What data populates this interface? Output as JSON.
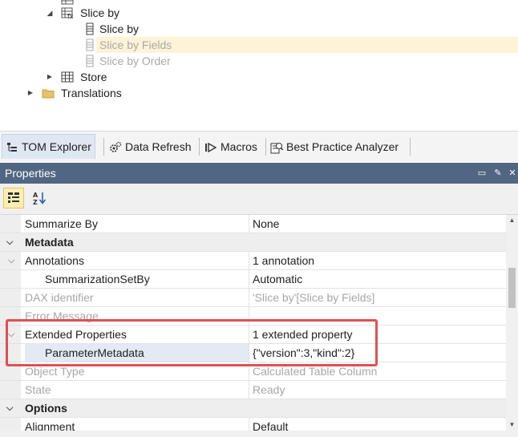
{
  "tree": {
    "items": [
      {
        "label": "Slice by"
      },
      {
        "label": "Slice by"
      },
      {
        "label": "Slice by Fields"
      },
      {
        "label": "Slice by Order"
      },
      {
        "label": "Store"
      },
      {
        "label": "Translations"
      }
    ]
  },
  "tabs": [
    {
      "label": "TOM Explorer"
    },
    {
      "label": "Data Refresh"
    },
    {
      "label": "Macros"
    },
    {
      "label": "Best Practice Analyzer"
    }
  ],
  "panel": {
    "title": "Properties"
  },
  "properties": {
    "rows": [
      {
        "name": "Summarize By",
        "value": "None"
      },
      {
        "name": "Metadata",
        "value": ""
      },
      {
        "name": "Annotations",
        "value": "1 annotation"
      },
      {
        "name": "SummarizationSetBy",
        "value": "Automatic"
      },
      {
        "name": "DAX identifier",
        "value": "'Slice by'[Slice by Fields]"
      },
      {
        "name": "Error Message",
        "value": ""
      },
      {
        "name": "Extended Properties",
        "value": "1 extended property"
      },
      {
        "name": "ParameterMetadata",
        "value": "{\"version\":3,\"kind\":2}"
      },
      {
        "name": "Object Type",
        "value": "Calculated Table Column"
      },
      {
        "name": "State",
        "value": "Ready"
      },
      {
        "name": "Options",
        "value": ""
      },
      {
        "name": "Alignment",
        "value": "Default"
      }
    ]
  },
  "colors": {
    "panel_header": "#506682",
    "highlight_row": "#fdf3d6",
    "annotation_box": "#e15050"
  }
}
